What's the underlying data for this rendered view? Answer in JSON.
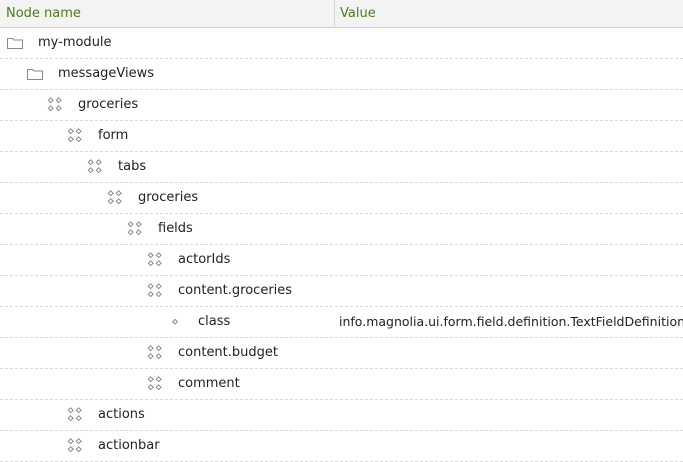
{
  "header": {
    "node_name": "Node name",
    "value": "Value"
  },
  "rows": [
    {
      "label": "my-module",
      "value": "",
      "icon": "folder-icon",
      "level": 0
    },
    {
      "label": "messageViews",
      "value": "",
      "icon": "folder-icon",
      "level": 1
    },
    {
      "label": "groceries",
      "value": "",
      "icon": "content-node-icon",
      "level": 2
    },
    {
      "label": "form",
      "value": "",
      "icon": "content-node-icon",
      "level": 3
    },
    {
      "label": "tabs",
      "value": "",
      "icon": "content-node-icon",
      "level": 4
    },
    {
      "label": "groceries",
      "value": "",
      "icon": "content-node-icon",
      "level": 5
    },
    {
      "label": "fields",
      "value": "",
      "icon": "content-node-icon",
      "level": 6
    },
    {
      "label": "actorIds",
      "value": "",
      "icon": "content-node-icon",
      "level": 7
    },
    {
      "label": "content.groceries",
      "value": "",
      "icon": "content-node-icon",
      "level": 7
    },
    {
      "label": "class",
      "value": "info.magnolia.ui.form.field.definition.TextFieldDefinition",
      "icon": "property-icon",
      "level": 8
    },
    {
      "label": "content.budget",
      "value": "",
      "icon": "content-node-icon",
      "level": 7
    },
    {
      "label": "comment",
      "value": "",
      "icon": "content-node-icon",
      "level": 7
    },
    {
      "label": "actions",
      "value": "",
      "icon": "content-node-icon",
      "level": 3
    },
    {
      "label": "actionbar",
      "value": "",
      "icon": "content-node-icon",
      "level": 3
    }
  ]
}
